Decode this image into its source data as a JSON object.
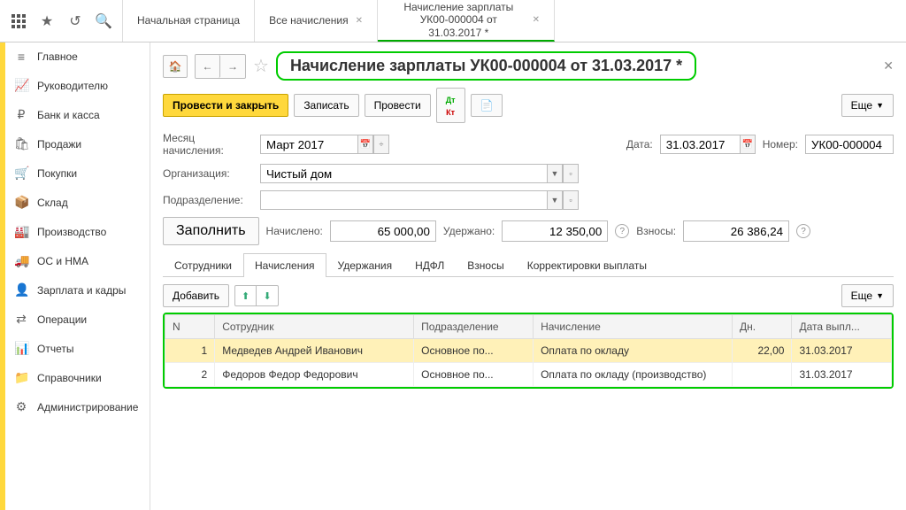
{
  "topTabs": [
    {
      "title": "Начальная страница",
      "closable": false
    },
    {
      "title": "Все начисления",
      "closable": true
    },
    {
      "title": "Начисление зарплаты УК00-000004 от 31.03.2017 *",
      "closable": true,
      "active": true
    }
  ],
  "sidebar": [
    {
      "icon": "≡",
      "label": "Главное"
    },
    {
      "icon": "📈",
      "label": "Руководителю"
    },
    {
      "icon": "₽",
      "label": "Банк и касса"
    },
    {
      "icon": "🛍",
      "label": "Продажи"
    },
    {
      "icon": "🛒",
      "label": "Покупки"
    },
    {
      "icon": "📦",
      "label": "Склад"
    },
    {
      "icon": "🏭",
      "label": "Производство"
    },
    {
      "icon": "🚚",
      "label": "ОС и НМА"
    },
    {
      "icon": "👤",
      "label": "Зарплата и кадры"
    },
    {
      "icon": "⇄",
      "label": "Операции"
    },
    {
      "icon": "📊",
      "label": "Отчеты"
    },
    {
      "icon": "📁",
      "label": "Справочники"
    },
    {
      "icon": "⚙",
      "label": "Администрирование"
    }
  ],
  "docTitle": "Начисление зарплаты УК00-000004 от 31.03.2017 *",
  "toolbar": {
    "postClose": "Провести и закрыть",
    "save": "Записать",
    "post": "Провести",
    "more": "Еще"
  },
  "form": {
    "monthLabel": "Месяц начисления:",
    "monthValue": "Март 2017",
    "dateLabel": "Дата:",
    "dateValue": "31.03.2017",
    "numberLabel": "Номер:",
    "numberValue": "УК00-000004",
    "orgLabel": "Организация:",
    "orgValue": "Чистый дом",
    "depLabel": "Подразделение:",
    "depValue": ""
  },
  "totals": {
    "fill": "Заполнить",
    "accruedLabel": "Начислено:",
    "accruedValue": "65 000,00",
    "withheldLabel": "Удержано:",
    "withheldValue": "12 350,00",
    "contribLabel": "Взносы:",
    "contribValue": "26 386,24"
  },
  "subtabs": [
    "Сотрудники",
    "Начисления",
    "Удержания",
    "НДФЛ",
    "Взносы",
    "Корректировки выплаты"
  ],
  "activeSubtab": 1,
  "tableToolbar": {
    "add": "Добавить",
    "more": "Еще"
  },
  "columns": [
    "N",
    "Сотрудник",
    "Подразделение",
    "Начисление",
    "Дн.",
    "Дата выпл..."
  ],
  "rows": [
    {
      "n": "1",
      "emp": "Медведев Андрей Иванович",
      "dep": "Основное по...",
      "nach": "Оплата по окладу",
      "days": "22,00",
      "date": "31.03.2017",
      "sel": true
    },
    {
      "n": "2",
      "emp": "Федоров Федор Федорович",
      "dep": "Основное по...",
      "nach": "Оплата по окладу (производство)",
      "days": "",
      "date": "31.03.2017",
      "sel": false
    }
  ]
}
